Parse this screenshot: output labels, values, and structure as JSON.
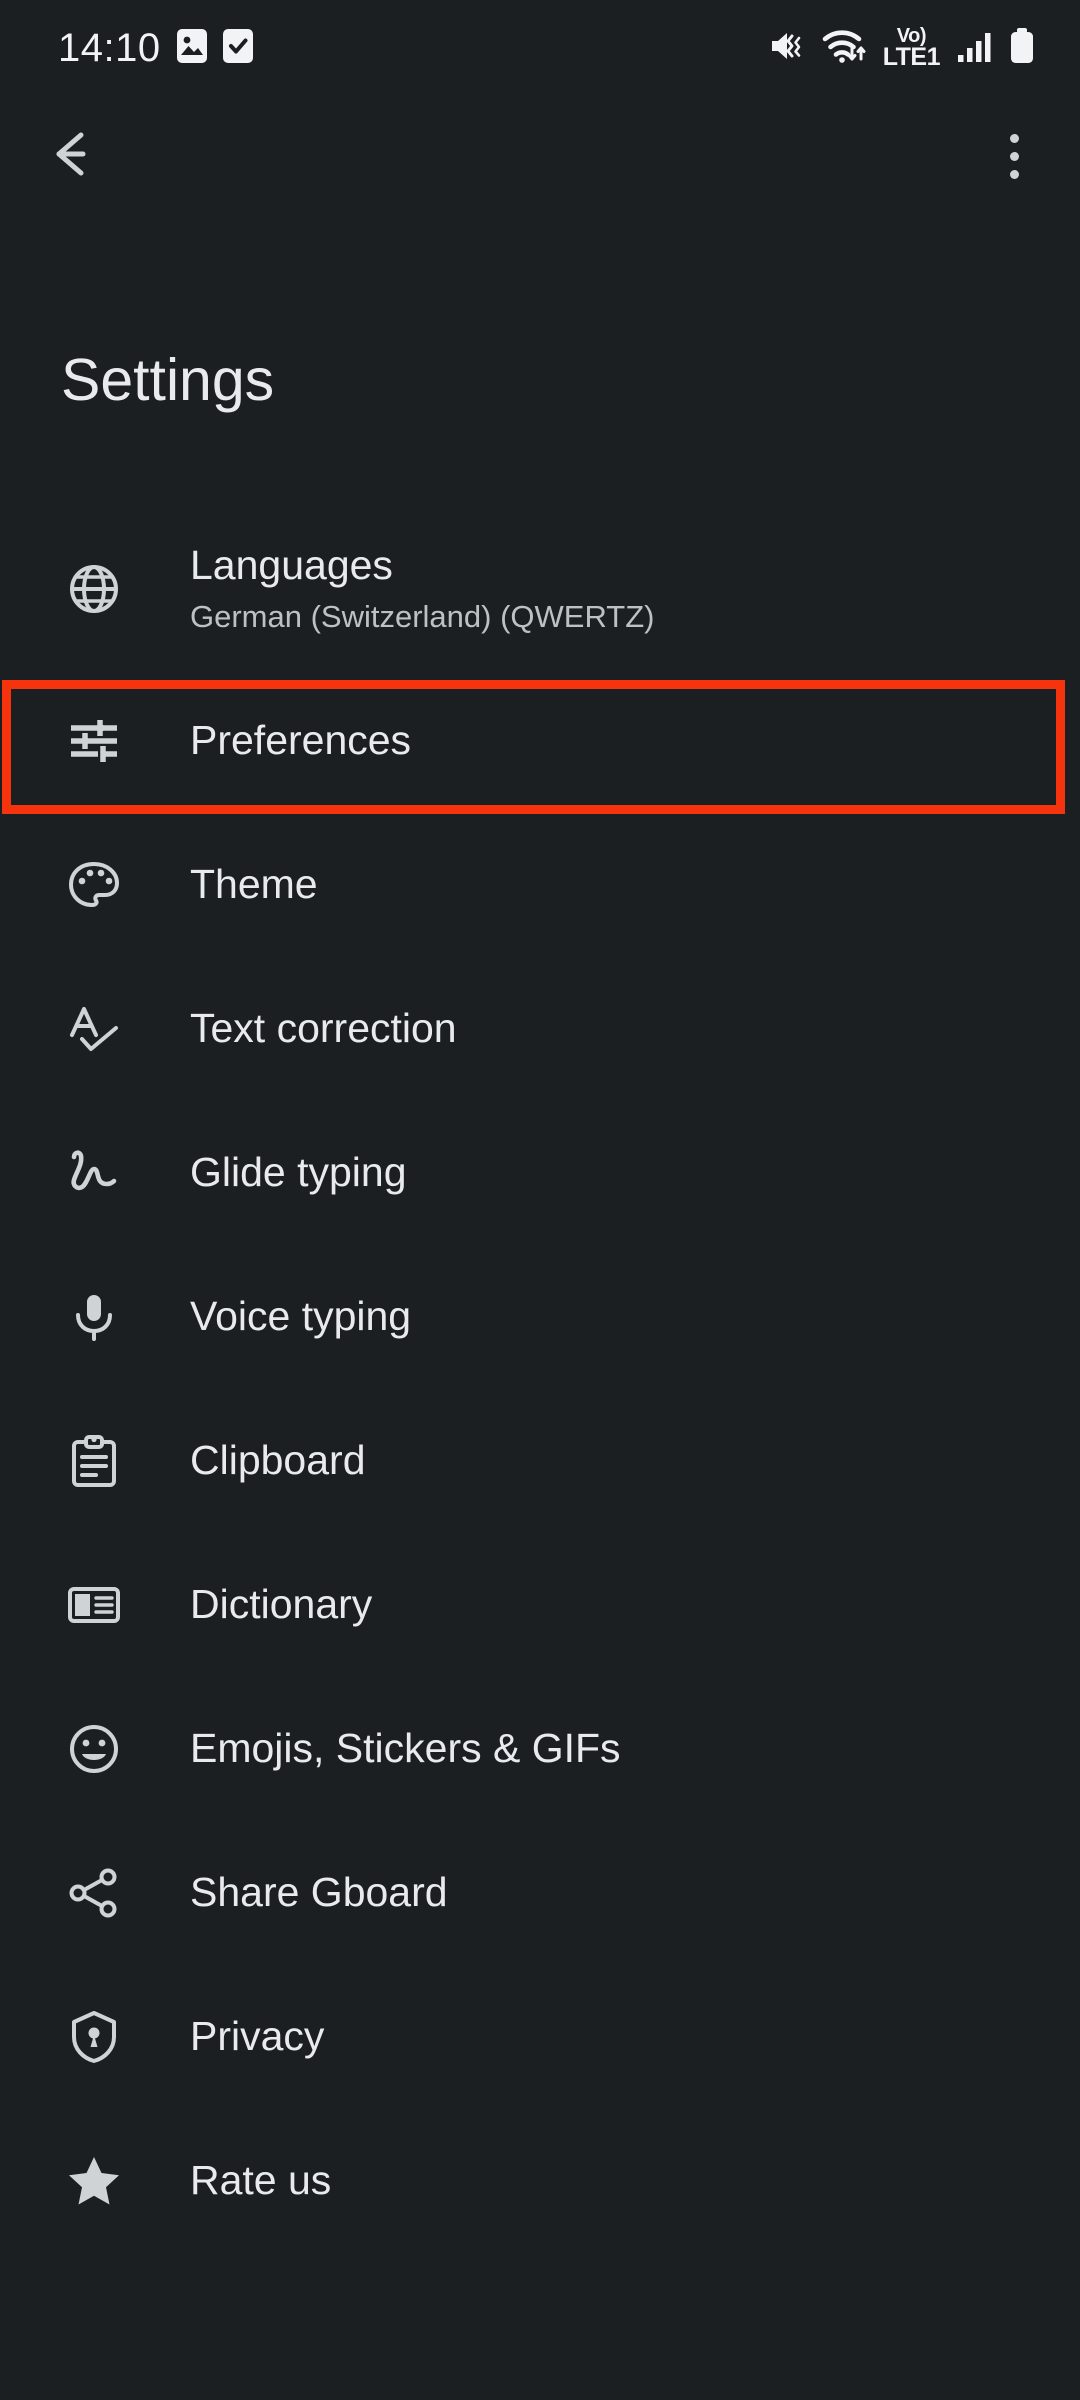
{
  "status_bar": {
    "time": "14:10",
    "left_icons": [
      "image-icon",
      "task-check-icon"
    ],
    "right_icons": [
      "volume-mute-vibrate-icon",
      "wifi-icon",
      "volte-icon",
      "signal-bars-icon",
      "battery-icon"
    ],
    "volte_label_top": "Vo)",
    "volte_label_bottom": "LTE1"
  },
  "app_bar": {
    "back_icon": "arrow-back-icon",
    "overflow_icon": "more-vert-icon"
  },
  "page": {
    "title": "Settings"
  },
  "settings_list": [
    {
      "icon": "globe-icon",
      "label": "Languages",
      "subtitle": "German (Switzerland) (QWERTZ)"
    },
    {
      "icon": "tune-icon",
      "label": "Preferences",
      "subtitle": ""
    },
    {
      "icon": "palette-icon",
      "label": "Theme",
      "subtitle": ""
    },
    {
      "icon": "spellcheck-icon",
      "label": "Text correction",
      "subtitle": ""
    },
    {
      "icon": "gesture-icon",
      "label": "Glide typing",
      "subtitle": ""
    },
    {
      "icon": "microphone-icon",
      "label": "Voice typing",
      "subtitle": ""
    },
    {
      "icon": "clipboard-icon",
      "label": "Clipboard",
      "subtitle": ""
    },
    {
      "icon": "dictionary-icon",
      "label": "Dictionary",
      "subtitle": ""
    },
    {
      "icon": "smiley-icon",
      "label": "Emojis, Stickers & GIFs",
      "subtitle": ""
    },
    {
      "icon": "share-icon",
      "label": "Share Gboard",
      "subtitle": ""
    },
    {
      "icon": "shield-lock-icon",
      "label": "Privacy",
      "subtitle": ""
    },
    {
      "icon": "star-icon",
      "label": "Rate us",
      "subtitle": ""
    }
  ],
  "highlight": {
    "target_label": "Preferences",
    "color": "#F5330C"
  },
  "colors": {
    "background": "#1b1f22",
    "primary_text": "#e8eaed",
    "secondary_text": "#bdc1c6",
    "icon": "#cfd3d6",
    "accent_highlight": "#F5330C"
  }
}
